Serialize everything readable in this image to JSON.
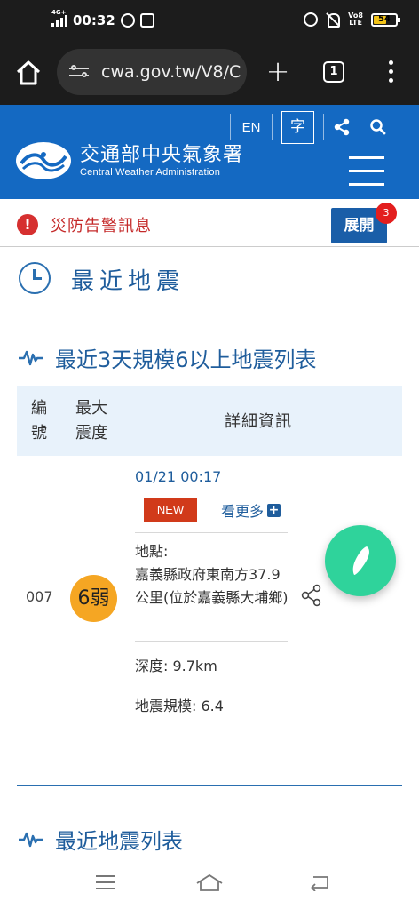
{
  "status_bar": {
    "network": "4G+",
    "time": "00:32",
    "volte": "Vo8 LTE",
    "battery": "54",
    "battery_level": 0.54
  },
  "browser": {
    "url": "cwa.gov.tw/V8/C",
    "tab_count": "1"
  },
  "header": {
    "lang": "EN",
    "font_size_label": "字",
    "logo_zh": "交通部中央氣象署",
    "logo_en": "Central Weather Administration"
  },
  "alert": {
    "text": "災防告警訊息",
    "icon_text": "!",
    "button": "展開",
    "badge": "3"
  },
  "page": {
    "title": "最近地震",
    "section1": "最近3天規模6以上地震列表",
    "section2": "最近地震列表"
  },
  "table": {
    "headers": {
      "no": "編號",
      "intensity": "最大震度",
      "details": "詳細資訊"
    },
    "rows": [
      {
        "no": "007",
        "intensity": "6弱",
        "time": "01/21 00:17",
        "tag": "NEW",
        "more": "看更多",
        "location": "地點:\n嘉義縣政府東南方37.9公里(位於嘉義縣大埔鄉)",
        "depth": "深度: 9.7km",
        "magnitude": "地震規模: 6.4"
      }
    ]
  },
  "colors": {
    "brand_blue": "#1469c2",
    "title_blue": "#1f5d9c",
    "alert_red": "#c52a2a",
    "intensity_orange": "#f5a623",
    "fab_green": "#2fd39b"
  }
}
